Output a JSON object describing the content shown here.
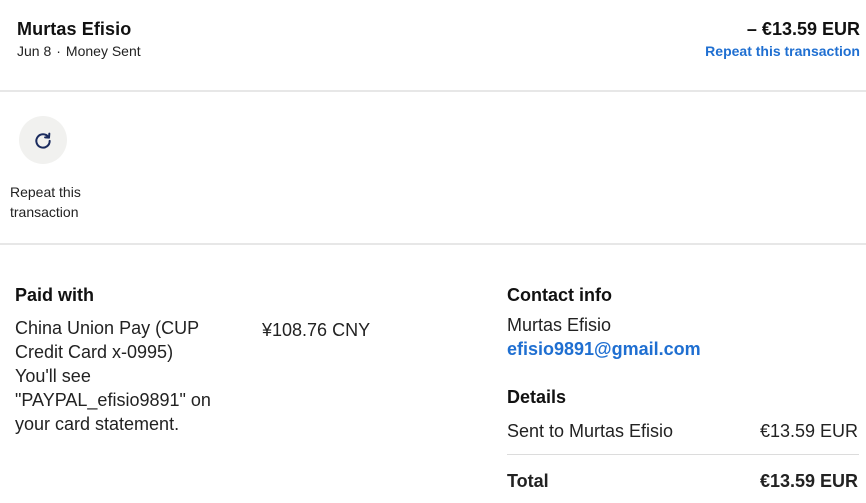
{
  "header": {
    "recipient_name": "Murtas Efisio",
    "date": "Jun 8",
    "separator": "·",
    "type": "Money Sent",
    "amount": "– €13.59 EUR",
    "repeat_link": "Repeat this transaction"
  },
  "actions": {
    "repeat_icon": "refresh-icon",
    "repeat_label": "Repeat this transaction"
  },
  "paid_with": {
    "title": "Paid with",
    "method": "China Union Pay (CUP Credit Card x-0995)",
    "statement_note": "You'll see \"PAYPAL_efisio9891\" on your card statement.",
    "amount": "¥108.76 CNY"
  },
  "contact": {
    "title": "Contact info",
    "name": "Murtas Efisio",
    "email": "efisio9891@gmail.com"
  },
  "details": {
    "title": "Details",
    "sent_label": "Sent to Murtas Efisio",
    "sent_amount": "€13.59 EUR",
    "total_label": "Total",
    "total_amount": "€13.59 EUR"
  },
  "colors": {
    "link": "#1f6fd1",
    "divider": "#e7e7e7",
    "icon_bg": "#f1f1ef",
    "icon": "#1a2b5e"
  }
}
